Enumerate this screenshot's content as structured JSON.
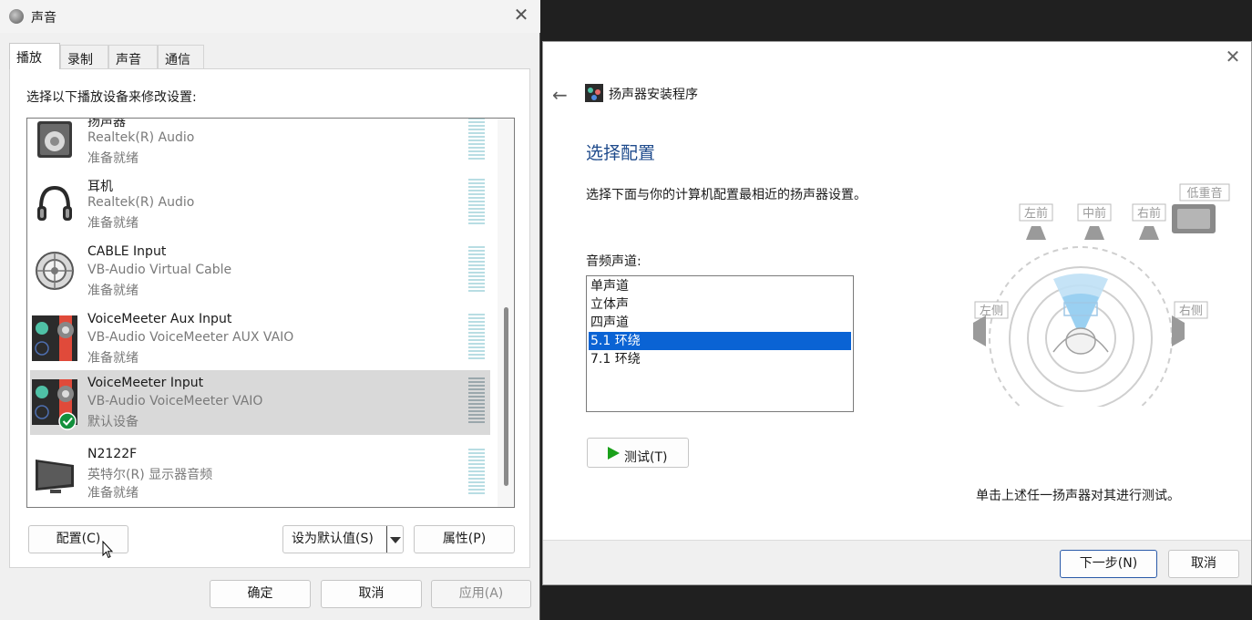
{
  "sound_dialog": {
    "title": "声音",
    "tabs": [
      "播放",
      "录制",
      "声音",
      "通信"
    ],
    "instruction": "选择以下播放设备来修改设置:",
    "devices": [
      {
        "name": "扬声器",
        "driver": "Realtek(R) Audio",
        "status": "准备就绪",
        "icon": "speaker-icon"
      },
      {
        "name": "耳机",
        "driver": "Realtek(R) Audio",
        "status": "准备就绪",
        "icon": "headphones-icon"
      },
      {
        "name": "CABLE Input",
        "driver": "VB-Audio Virtual Cable",
        "status": "准备就绪",
        "icon": "cable-icon"
      },
      {
        "name": "VoiceMeeter Aux Input",
        "driver": "VB-Audio VoiceMeeter AUX VAIO",
        "status": "准备就绪",
        "icon": "voicemeeter-icon"
      },
      {
        "name": "VoiceMeeter Input",
        "driver": "VB-Audio VoiceMeeter VAIO",
        "status": "默认设备",
        "icon": "voicemeeter-icon",
        "selected": true,
        "default": true
      },
      {
        "name": "N2122F",
        "driver": "英特尔(R) 显示器音频",
        "status": "准备就绪",
        "icon": "monitor-icon"
      }
    ],
    "buttons": {
      "configure": "配置(C)",
      "set_default": "设为默认值(S)",
      "properties": "属性(P)",
      "ok": "确定",
      "cancel": "取消",
      "apply": "应用(A)"
    }
  },
  "speaker_setup": {
    "window_title": "扬声器安装程序",
    "heading": "选择配置",
    "description": "选择下面与你的计算机配置最相近的扬声器设置。",
    "channels_label": "音频声道:",
    "channels": [
      "单声道",
      "立体声",
      "四声道",
      "5.1 环绕",
      "7.1 环绕"
    ],
    "selected_channel": "5.1 环绕",
    "test_button": "测试(T)",
    "hint": "单击上述任一扬声器对其进行测试。",
    "diagram": {
      "front_left": "左前",
      "center": "中前",
      "front_right": "右前",
      "subwoofer": "低重音",
      "side_left": "左侧",
      "side_right": "右侧"
    },
    "buttons": {
      "next": "下一步(N)",
      "cancel": "取消"
    },
    "selection_color": "#0a63d4",
    "heading_color": "#1f4b8c"
  }
}
